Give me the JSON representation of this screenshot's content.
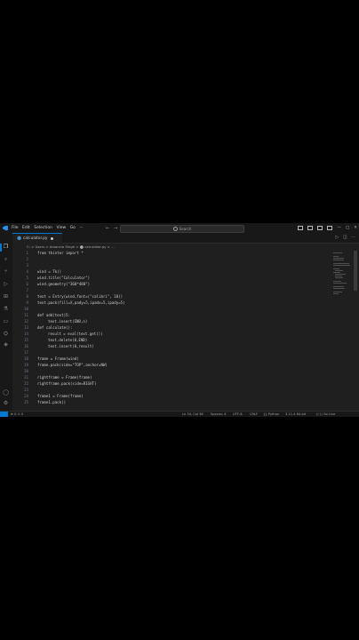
{
  "menu": [
    "File",
    "Edit",
    "Selection",
    "View",
    "Go",
    "···"
  ],
  "search": {
    "placeholder": "Search"
  },
  "tab": {
    "filename": "calculator.py"
  },
  "breadcrumb": "C: > Users > Amancia Singh > ⬤ calculator.py > ...",
  "code": [
    {
      "n": "1",
      "t": "from tkinter import *"
    },
    {
      "n": "2",
      "t": ""
    },
    {
      "n": "3",
      "t": ""
    },
    {
      "n": "4",
      "t": "wind = Tk()"
    },
    {
      "n": "5",
      "t": "wind.title(\"Calculator\")"
    },
    {
      "n": "6",
      "t": "wind.geometry(\"360*480\")"
    },
    {
      "n": "7",
      "t": ""
    },
    {
      "n": "8",
      "t": "text = Entry(wind,font=(\"calibri\", 18))"
    },
    {
      "n": "9",
      "t": "text.pack(fill=X,pady=5,ipadx=5,ipady=5)"
    },
    {
      "n": "10",
      "t": ""
    },
    {
      "n": "11",
      "t": "def add(text)5:"
    },
    {
      "n": "12",
      "t": "    text.insert(END,n)"
    },
    {
      "n": "13",
      "t": "def calculate():"
    },
    {
      "n": "14",
      "t": "    result = eval(text.get())"
    },
    {
      "n": "15",
      "t": "    text.delete(0,END)"
    },
    {
      "n": "16",
      "t": "    text.insert(0,result)"
    },
    {
      "n": "17",
      "t": ""
    },
    {
      "n": "18",
      "t": "frame = Frame(wind)"
    },
    {
      "n": "19",
      "t": "frame.pack(side=\"TOP\",anchor=NW)"
    },
    {
      "n": "20",
      "t": ""
    },
    {
      "n": "21",
      "t": "rightframe = Frame(frame)"
    },
    {
      "n": "22",
      "t": "rightframe.pack(side=RIGHT)"
    },
    {
      "n": "23",
      "t": ""
    },
    {
      "n": "24",
      "t": "frame1 = Frame(frame)"
    },
    {
      "n": "25",
      "t": "frame1.pack()"
    }
  ],
  "status": {
    "errors": "⊗ 0 ⚠ 0",
    "position": "Ln 34, Col 36",
    "spaces": "Spaces: 4",
    "encoding": "UTF-8",
    "eol": "CRLF",
    "language": "{} Python",
    "version": "3.11.4 64-bit",
    "golive": "((·)) Go Live"
  },
  "colors": {
    "accent": "#0078d4",
    "editor_bg": "#1f1f1f",
    "chrome_bg": "#181818"
  }
}
